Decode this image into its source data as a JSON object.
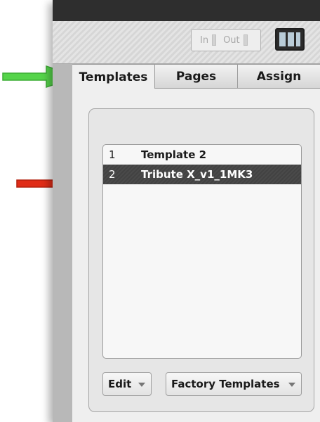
{
  "toolbar": {
    "in_label": "In",
    "out_label": "Out"
  },
  "tabs": [
    {
      "label": "Templates"
    },
    {
      "label": "Pages"
    },
    {
      "label": "Assign"
    }
  ],
  "templates": [
    {
      "num": "1",
      "name": "Template 2"
    },
    {
      "num": "2",
      "name": "Tribute X_v1_1MK3"
    }
  ],
  "selected_template": "2",
  "buttons": {
    "edit_label": "Edit",
    "factory_label": "Factory Templates"
  },
  "colors": {
    "green_arrow": "#55d44a",
    "red_arrow": "#e02c17",
    "selection": "#474747"
  }
}
